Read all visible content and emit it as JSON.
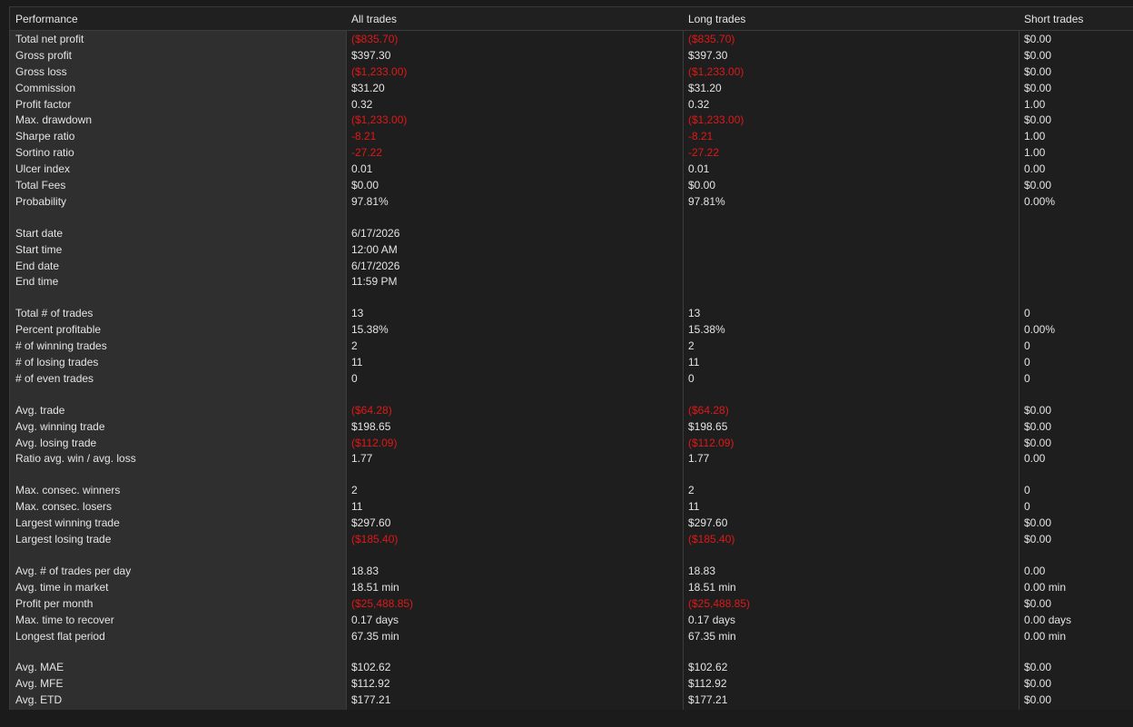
{
  "header": {
    "performance": "Performance",
    "all": "All trades",
    "long": "Long trades",
    "short": "Short trades"
  },
  "colors": {
    "negative": "#e01818",
    "text": "#e4e4e4",
    "label_bg": "#2f2f2f"
  },
  "rows": [
    {
      "label": "Total net profit",
      "all": "($835.70)",
      "long": "($835.70)",
      "short": "$0.00",
      "neg": [
        true,
        true,
        false
      ]
    },
    {
      "label": "Gross profit",
      "all": "$397.30",
      "long": "$397.30",
      "short": "$0.00",
      "neg": [
        false,
        false,
        false
      ]
    },
    {
      "label": "Gross loss",
      "all": "($1,233.00)",
      "long": "($1,233.00)",
      "short": "$0.00",
      "neg": [
        true,
        true,
        false
      ]
    },
    {
      "label": "Commission",
      "all": "$31.20",
      "long": "$31.20",
      "short": "$0.00",
      "neg": [
        false,
        false,
        false
      ]
    },
    {
      "label": "Profit factor",
      "all": "0.32",
      "long": "0.32",
      "short": "1.00",
      "neg": [
        false,
        false,
        false
      ]
    },
    {
      "label": "Max. drawdown",
      "all": "($1,233.00)",
      "long": "($1,233.00)",
      "short": "$0.00",
      "neg": [
        true,
        true,
        false
      ]
    },
    {
      "label": "Sharpe ratio",
      "all": "-8.21",
      "long": "-8.21",
      "short": "1.00",
      "neg": [
        true,
        true,
        false
      ]
    },
    {
      "label": "Sortino ratio",
      "all": "-27.22",
      "long": "-27.22",
      "short": "1.00",
      "neg": [
        true,
        true,
        false
      ]
    },
    {
      "label": "Ulcer index",
      "all": "0.01",
      "long": "0.01",
      "short": "0.00",
      "neg": [
        false,
        false,
        false
      ]
    },
    {
      "label": "Total Fees",
      "all": "$0.00",
      "long": "$0.00",
      "short": "$0.00",
      "neg": [
        false,
        false,
        false
      ]
    },
    {
      "label": "Probability",
      "all": "97.81%",
      "long": "97.81%",
      "short": "0.00%",
      "neg": [
        false,
        false,
        false
      ]
    },
    {
      "spacer": true
    },
    {
      "label": "Start date",
      "all": "6/17/2026",
      "long": "",
      "short": "",
      "neg": [
        false,
        false,
        false
      ]
    },
    {
      "label": "Start time",
      "all": "12:00 AM",
      "long": "",
      "short": "",
      "neg": [
        false,
        false,
        false
      ]
    },
    {
      "label": "End date",
      "all": "6/17/2026",
      "long": "",
      "short": "",
      "neg": [
        false,
        false,
        false
      ]
    },
    {
      "label": "End time",
      "all": "11:59 PM",
      "long": "",
      "short": "",
      "neg": [
        false,
        false,
        false
      ]
    },
    {
      "spacer": true
    },
    {
      "label": "Total # of trades",
      "all": "13",
      "long": "13",
      "short": "0",
      "neg": [
        false,
        false,
        false
      ]
    },
    {
      "label": "Percent profitable",
      "all": "15.38%",
      "long": "15.38%",
      "short": "0.00%",
      "neg": [
        false,
        false,
        false
      ]
    },
    {
      "label": "# of winning trades",
      "all": "2",
      "long": "2",
      "short": "0",
      "neg": [
        false,
        false,
        false
      ]
    },
    {
      "label": "# of losing trades",
      "all": "11",
      "long": "11",
      "short": "0",
      "neg": [
        false,
        false,
        false
      ]
    },
    {
      "label": "# of even trades",
      "all": "0",
      "long": "0",
      "short": "0",
      "neg": [
        false,
        false,
        false
      ]
    },
    {
      "spacer": true
    },
    {
      "label": "Avg. trade",
      "all": "($64.28)",
      "long": "($64.28)",
      "short": "$0.00",
      "neg": [
        true,
        true,
        false
      ]
    },
    {
      "label": "Avg. winning trade",
      "all": "$198.65",
      "long": "$198.65",
      "short": "$0.00",
      "neg": [
        false,
        false,
        false
      ]
    },
    {
      "label": "Avg. losing trade",
      "all": "($112.09)",
      "long": "($112.09)",
      "short": "$0.00",
      "neg": [
        true,
        true,
        false
      ]
    },
    {
      "label": "Ratio avg. win / avg. loss",
      "all": "1.77",
      "long": "1.77",
      "short": "0.00",
      "neg": [
        false,
        false,
        false
      ]
    },
    {
      "spacer": true
    },
    {
      "label": "Max. consec. winners",
      "all": "2",
      "long": "2",
      "short": "0",
      "neg": [
        false,
        false,
        false
      ]
    },
    {
      "label": "Max. consec. losers",
      "all": "11",
      "long": "11",
      "short": "0",
      "neg": [
        false,
        false,
        false
      ]
    },
    {
      "label": "Largest winning trade",
      "all": "$297.60",
      "long": "$297.60",
      "short": "$0.00",
      "neg": [
        false,
        false,
        false
      ]
    },
    {
      "label": "Largest losing trade",
      "all": "($185.40)",
      "long": "($185.40)",
      "short": "$0.00",
      "neg": [
        true,
        true,
        false
      ]
    },
    {
      "spacer": true
    },
    {
      "label": "Avg. # of trades per day",
      "all": "18.83",
      "long": "18.83",
      "short": "0.00",
      "neg": [
        false,
        false,
        false
      ]
    },
    {
      "label": "Avg. time in market",
      "all": "18.51 min",
      "long": "18.51 min",
      "short": "0.00 min",
      "neg": [
        false,
        false,
        false
      ]
    },
    {
      "label": "Profit per month",
      "all": "($25,488.85)",
      "long": "($25,488.85)",
      "short": "$0.00",
      "neg": [
        true,
        true,
        false
      ]
    },
    {
      "label": "Max. time to recover",
      "all": "0.17 days",
      "long": "0.17 days",
      "short": "0.00 days",
      "neg": [
        false,
        false,
        false
      ]
    },
    {
      "label": "Longest flat period",
      "all": "67.35 min",
      "long": "67.35 min",
      "short": "0.00 min",
      "neg": [
        false,
        false,
        false
      ]
    },
    {
      "spacer": true
    },
    {
      "label": "Avg. MAE",
      "all": "$102.62",
      "long": "$102.62",
      "short": "$0.00",
      "neg": [
        false,
        false,
        false
      ]
    },
    {
      "label": "Avg. MFE",
      "all": "$112.92",
      "long": "$112.92",
      "short": "$0.00",
      "neg": [
        false,
        false,
        false
      ]
    },
    {
      "label": "Avg. ETD",
      "all": "$177.21",
      "long": "$177.21",
      "short": "$0.00",
      "neg": [
        false,
        false,
        false
      ]
    }
  ]
}
